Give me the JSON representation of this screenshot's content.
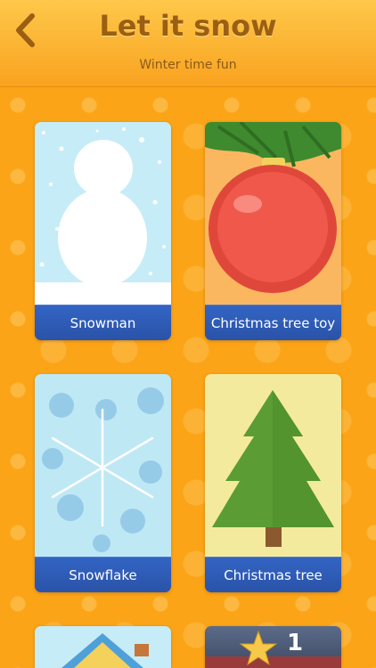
{
  "header": {
    "title": "Let it snow",
    "subtitle": "Winter time fun"
  },
  "cards": [
    {
      "label": "Snowman",
      "art": "snowman-silhouette"
    },
    {
      "label": "Christmas tree toy",
      "art": "ornament-ball"
    },
    {
      "label": "Snowflake",
      "art": "snowflake"
    },
    {
      "label": "Christmas tree",
      "art": "christmas-tree"
    }
  ],
  "partial_cards": [
    {
      "art": "house-roof"
    },
    {
      "art": "star-badge",
      "count": "1"
    }
  ],
  "colors": {
    "header_top": "#fec84a",
    "background": "#fba417",
    "label_bg": "#2a53a8",
    "title_text": "#9a5f12"
  }
}
